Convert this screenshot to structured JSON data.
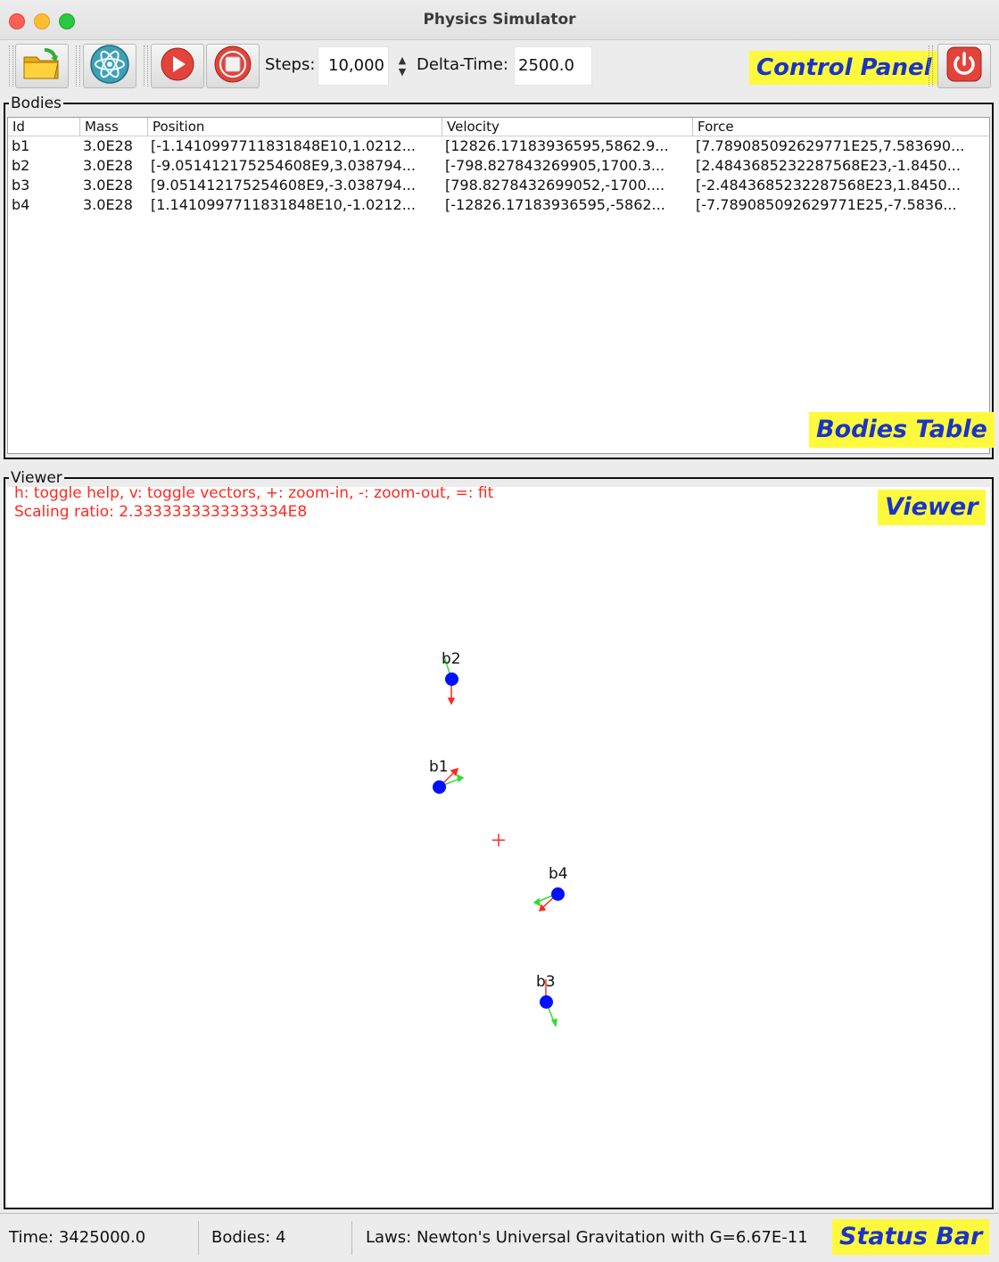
{
  "window": {
    "title": "Physics Simulator"
  },
  "toolbar": {
    "open_icon": "folder-open-icon",
    "physics_icon": "atom-icon",
    "run_icon": "play-icon",
    "stop_icon": "stop-icon",
    "exit_icon": "power-icon",
    "steps_label": "Steps:",
    "steps_value": "10,000",
    "dt_label": "Delta-Time:",
    "dt_value": "2500.0",
    "note": "Control Panel"
  },
  "bodies_panel": {
    "title": "Bodies",
    "columns": [
      "Id",
      "Mass",
      "Position",
      "Velocity",
      "Force"
    ],
    "rows": [
      [
        "b1",
        "3.0E28",
        "[-1.1410997711831848E10,1.0212...",
        "[12826.17183936595,5862.9...",
        "[7.789085092629771E25,7.583690..."
      ],
      [
        "b2",
        "3.0E28",
        "[-9.051412175254608E9,3.038794...",
        "[-798.827843269905,1700.3...",
        "[2.4843685232287568E23,-1.8450..."
      ],
      [
        "b3",
        "3.0E28",
        "[9.051412175254608E9,-3.038794...",
        "[798.8278432699052,-1700....",
        "[-2.4843685232287568E23,1.8450..."
      ],
      [
        "b4",
        "3.0E28",
        "[1.1410997711831848E10,-1.0212...",
        "[-12826.17183936595,-5862...",
        "[-7.789085092629771E25,-7.5836..."
      ]
    ],
    "note": "Bodies Table"
  },
  "viewer": {
    "title": "Viewer",
    "help": "h: toggle help, v: toggle vectors, +: zoom-in, -: zoom-out, =: fit",
    "scaling": "Scaling ratio:  2.3333333333333334E8",
    "note": "Viewer",
    "bodies": [
      {
        "id": "b2"
      },
      {
        "id": "b1"
      },
      {
        "id": "b4"
      },
      {
        "id": "b3"
      }
    ],
    "colors": {
      "body": "#0010ff",
      "force": "#ff2a1f",
      "velocity": "#33dd33",
      "origin": "#ff2a1f"
    }
  },
  "status": {
    "time": "Time:  3425000.0",
    "bodies": "Bodies:  4",
    "laws": "Laws:  Newton's Universal Gravitation with G=6.67E-11",
    "note": "Status Bar"
  }
}
